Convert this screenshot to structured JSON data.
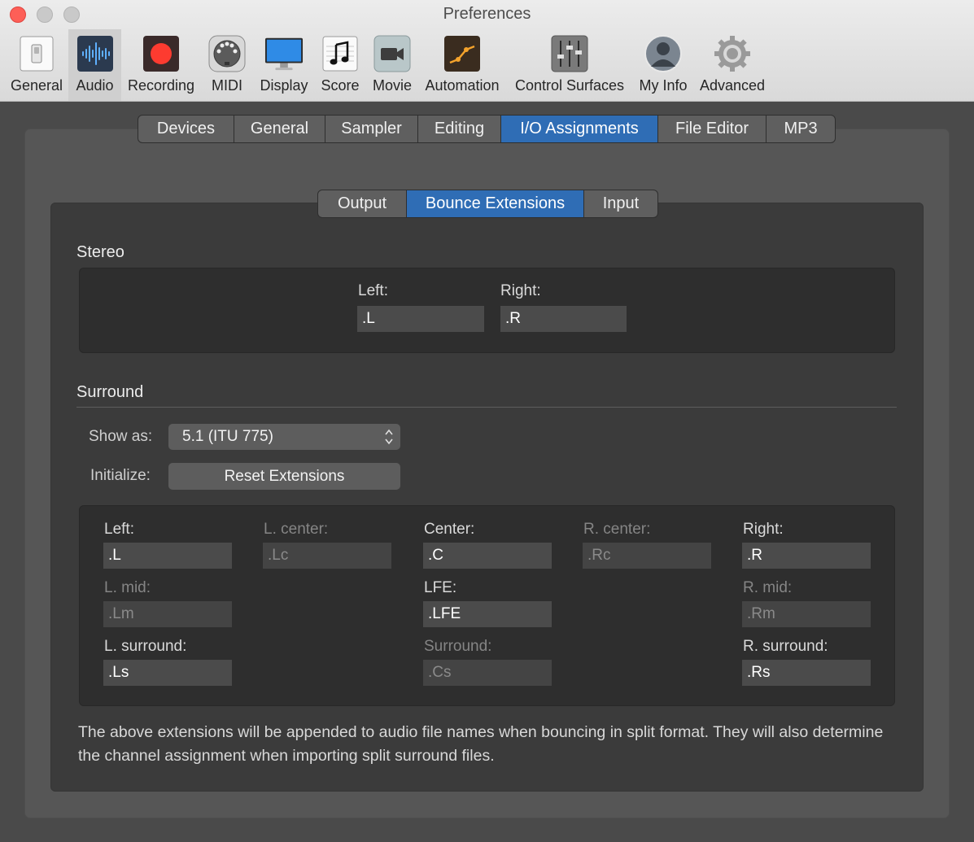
{
  "window": {
    "title": "Preferences"
  },
  "toolbar": {
    "items": [
      {
        "label": "General",
        "icon": "switch-icon"
      },
      {
        "label": "Audio",
        "icon": "waveform-icon",
        "selected": true
      },
      {
        "label": "Recording",
        "icon": "record-icon"
      },
      {
        "label": "MIDI",
        "icon": "midi-connector-icon"
      },
      {
        "label": "Display",
        "icon": "monitor-icon"
      },
      {
        "label": "Score",
        "icon": "music-note-icon"
      },
      {
        "label": "Movie",
        "icon": "video-camera-icon"
      },
      {
        "label": "Automation",
        "icon": "automation-curve-icon"
      },
      {
        "label": "Control Surfaces",
        "icon": "faders-icon"
      },
      {
        "label": "My Info",
        "icon": "user-silhouette-icon"
      },
      {
        "label": "Advanced",
        "icon": "gear-icon"
      }
    ]
  },
  "tabs": {
    "items": [
      "Devices",
      "General",
      "Sampler",
      "Editing",
      "I/O Assignments",
      "File Editor",
      "MP3"
    ],
    "active": "I/O Assignments"
  },
  "subtabs": {
    "items": [
      "Output",
      "Bounce Extensions",
      "Input"
    ],
    "active": "Bounce Extensions"
  },
  "stereo": {
    "heading": "Stereo",
    "left_label": "Left:",
    "left_value": ".L",
    "right_label": "Right:",
    "right_value": ".R"
  },
  "surround": {
    "heading": "Surround",
    "show_as_label": "Show as:",
    "show_as_value": "5.1 (ITU 775)",
    "initialize_label": "Initialize:",
    "reset_button": "Reset Extensions",
    "channels": {
      "left": {
        "label": "Left:",
        "value": ".L"
      },
      "l_center": {
        "label": "L. center:",
        "value": ".Lc"
      },
      "center": {
        "label": "Center:",
        "value": ".C"
      },
      "r_center": {
        "label": "R. center:",
        "value": ".Rc"
      },
      "right": {
        "label": "Right:",
        "value": ".R"
      },
      "l_mid": {
        "label": "L. mid:",
        "value": ".Lm"
      },
      "lfe": {
        "label": "LFE:",
        "value": ".LFE"
      },
      "r_mid": {
        "label": "R. mid:",
        "value": ".Rm"
      },
      "l_surround": {
        "label": "L. surround:",
        "value": ".Ls"
      },
      "surround": {
        "label": "Surround:",
        "value": ".Cs"
      },
      "r_surround": {
        "label": "R. surround:",
        "value": ".Rs"
      }
    }
  },
  "note": "The above extensions will be appended to audio file names when bouncing in split format. They will also determine the channel assignment when importing split surround files.",
  "colors": {
    "accent": "#2f6db5",
    "record": "#fd3b30"
  }
}
